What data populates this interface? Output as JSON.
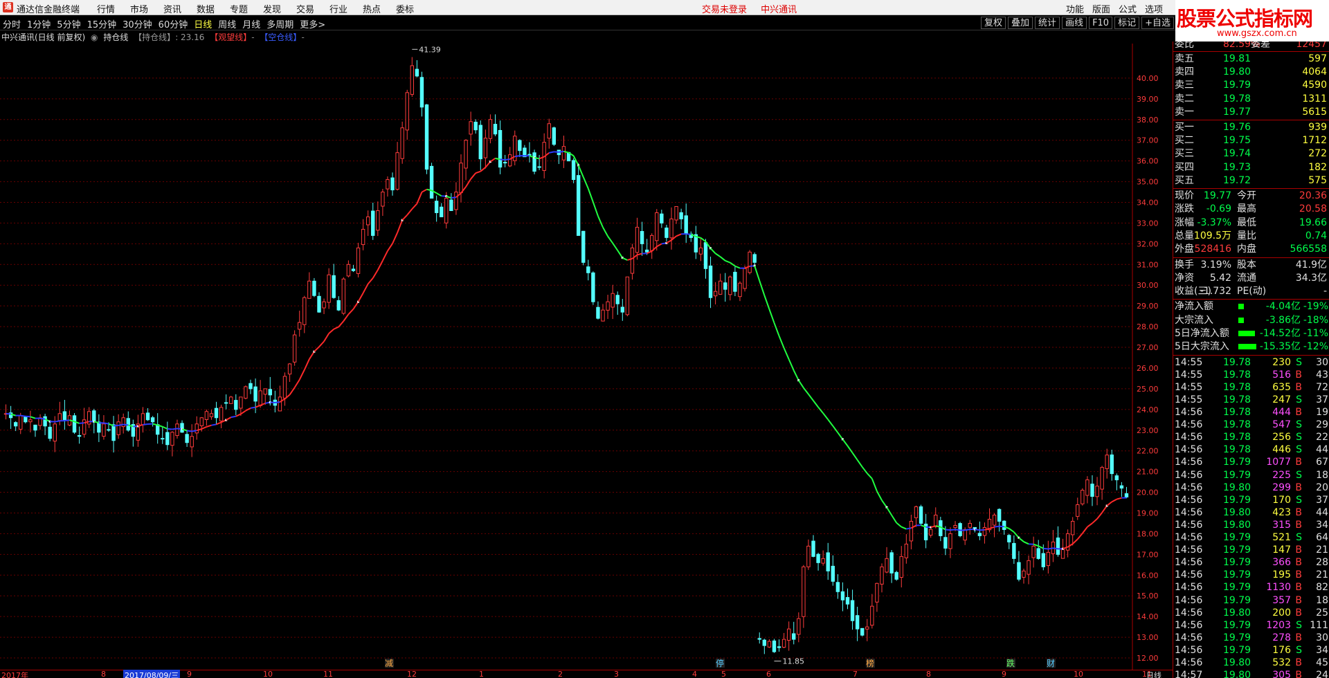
{
  "titlebar": {
    "logo": "通",
    "app_title": "通达信金融终端",
    "menu": [
      "行情",
      "市场",
      "资讯",
      "数据",
      "专题",
      "发现",
      "交易",
      "行业",
      "热点",
      "委标"
    ],
    "center": [
      "交易未登录",
      "中兴通讯"
    ],
    "right_menu": [
      "功能",
      "版面",
      "公式",
      "选项"
    ],
    "watermark_title": "股票公式指标网",
    "watermark_url": "www.gszx.com.cn"
  },
  "toolbar": {
    "periods": [
      "分时",
      "1分钟",
      "5分钟",
      "15分钟",
      "30分钟",
      "60分钟",
      "日线",
      "周线",
      "月线",
      "多周期",
      "更多>"
    ],
    "active_period": "日线",
    "tools": [
      "复权",
      "叠加",
      "统计",
      "画线",
      "F10",
      "标记",
      "+自选",
      "返回"
    ]
  },
  "infobar": {
    "stock": "中兴通讯(日线 前复权)",
    "indicator": "持仓线",
    "label_hold": "【持仓线】",
    "hold_value": ": 23.16",
    "label_watch": "【观望线】",
    "label_short": "【空仓线】",
    "dash": "-"
  },
  "chart_data": {
    "type": "candlestick",
    "y_axis_ticks": [
      "40.00",
      "39.00",
      "38.00",
      "37.00",
      "36.00",
      "35.00",
      "34.00",
      "33.00",
      "32.00",
      "31.00",
      "30.00",
      "29.00",
      "28.00",
      "27.00",
      "26.00",
      "25.00",
      "24.00",
      "23.00",
      "22.00",
      "21.00",
      "20.00",
      "19.00",
      "18.00",
      "17.00",
      "16.00",
      "15.00",
      "14.00",
      "13.00",
      "12.00"
    ],
    "ylim": [
      11.6,
      41.5
    ],
    "high_label": "41.39",
    "low_label": "11.85",
    "date_labels": [
      "2017年",
      "8",
      "2017/08/09/三",
      "9",
      "10",
      "11",
      "12",
      "1",
      "2",
      "3",
      "4",
      "5",
      "6",
      "7",
      "8",
      "9",
      "10",
      "11",
      "日线"
    ],
    "event_markers": [
      "减",
      "停",
      "榜",
      "跌",
      "财"
    ],
    "closes": [
      23.8,
      23.6,
      23.2,
      23.7,
      23.4,
      23.5,
      23.0,
      23.6,
      23.2,
      22.6,
      23.3,
      23.8,
      23.5,
      23.7,
      22.9,
      22.7,
      23.5,
      23.9,
      23.4,
      22.9,
      23.3,
      23.0,
      22.5,
      23.4,
      23.6,
      23.0,
      22.7,
      23.3,
      23.8,
      23.5,
      23.4,
      22.8,
      22.6,
      22.3,
      22.9,
      23.3,
      22.9,
      22.4,
      22.7,
      23.3,
      23.6,
      23.9,
      23.8,
      23.6,
      24.1,
      24.3,
      24.6,
      24.0,
      24.6,
      25.1,
      25.0,
      24.4,
      24.9,
      25.0,
      24.7,
      24.2,
      24.6,
      25.6,
      26.2,
      27.6,
      28.2,
      29.4,
      30.2,
      29.5,
      28.7,
      29.2,
      30.5,
      29.4,
      28.8,
      30.3,
      31.0,
      30.7,
      31.8,
      32.7,
      33.3,
      32.4,
      33.6,
      34.5,
      35.1,
      34.6,
      36.4,
      37.6,
      39.3,
      40.6,
      40.1,
      38.6,
      35.6,
      34.2,
      33.5,
      33.3,
      34.2,
      33.6,
      34.5,
      35.9,
      37.0,
      37.9,
      37.5,
      36.1,
      37.1,
      38.0,
      37.3,
      35.7,
      35.9,
      36.3,
      37.2,
      36.5,
      36.2,
      36.3,
      35.5,
      35.7,
      36.9,
      37.8,
      36.8,
      36.3,
      36.7,
      36.0,
      35.1,
      32.4,
      31.1,
      30.6,
      29.2,
      28.4,
      28.8,
      29.2,
      29.6,
      29.1,
      28.7,
      30.4,
      31.8,
      32.8,
      32.0,
      31.6,
      32.4,
      33.5,
      33.0,
      32.3,
      33.2,
      33.8,
      33.2,
      32.5,
      32.3,
      31.6,
      31.8,
      30.8,
      29.4,
      29.7,
      30.2,
      29.8,
      30.4,
      29.7,
      30.1,
      30.8,
      31.6,
      31.1,
      12.9,
      12.6,
      12.8,
      12.3,
      12.5,
      12.9,
      13.4,
      12.9,
      13.9,
      16.4,
      17.4,
      16.9,
      16.6,
      16.8,
      16.2,
      15.7,
      15.2,
      14.8,
      14.6,
      13.8,
      13.4,
      13.1,
      13.5,
      14.5,
      15.6,
      16.4,
      16.8,
      16.1,
      15.8,
      16.9,
      17.5,
      18.6,
      19.3,
      18.5,
      17.7,
      18.2,
      18.9,
      17.9,
      17.3,
      18.0,
      18.4,
      17.9,
      18.2,
      18.5,
      18.2,
      17.9,
      18.3,
      18.7,
      18.9,
      18.6,
      18.2,
      17.6,
      16.8,
      15.8,
      16.2,
      16.7,
      17.4,
      16.8,
      16.4,
      17.1,
      17.6,
      17.0,
      17.3,
      18.0,
      18.6,
      19.4,
      20.1,
      20.6,
      19.8,
      20.3,
      21.2,
      21.8,
      20.9,
      20.6,
      20.2,
      19.77
    ]
  },
  "panel": {
    "top_row": {
      "label": "委比",
      "value": "82.59%",
      "label2": "委差",
      "value2": "12457"
    },
    "sell": [
      {
        "label": "卖五",
        "price": "19.81",
        "vol": "597"
      },
      {
        "label": "卖四",
        "price": "19.80",
        "vol": "4064"
      },
      {
        "label": "卖三",
        "price": "19.79",
        "vol": "4590"
      },
      {
        "label": "卖二",
        "price": "19.78",
        "vol": "1311"
      },
      {
        "label": "卖一",
        "price": "19.77",
        "vol": "5615"
      }
    ],
    "buy": [
      {
        "label": "买一",
        "price": "19.76",
        "vol": "939"
      },
      {
        "label": "买二",
        "price": "19.75",
        "vol": "1712"
      },
      {
        "label": "买三",
        "price": "19.74",
        "vol": "272"
      },
      {
        "label": "买四",
        "price": "19.73",
        "vol": "182"
      },
      {
        "label": "买五",
        "price": "19.72",
        "vol": "575"
      }
    ],
    "quote": [
      {
        "l1": "现价",
        "v1": "19.77",
        "l2": "今开",
        "v2": "20.36"
      },
      {
        "l1": "涨跌",
        "v1": "-0.69",
        "l2": "最高",
        "v2": "20.58"
      },
      {
        "l1": "涨幅",
        "v1": "-3.37%",
        "l2": "最低",
        "v2": "19.66"
      },
      {
        "l1": "总量",
        "v1": "109.5万",
        "l2": "量比",
        "v2": "0.74"
      },
      {
        "l1": "外盘",
        "v1": "528416",
        "l2": "内盘",
        "v2": "566558"
      }
    ],
    "stats": [
      {
        "l1": "换手",
        "v1": "3.19%",
        "l2": "股本",
        "v2": "41.9亿"
      },
      {
        "l1": "净资",
        "v1": "5.42",
        "l2": "流通",
        "v2": "34.3亿"
      },
      {
        "l1": "收益(三)",
        "v1": "-1.732",
        "l2": "PE(动)",
        "v2": "-"
      }
    ],
    "flows": [
      {
        "label": "净流入额",
        "value": "-4.04亿",
        "pct": "-19%",
        "bar": 0.2
      },
      {
        "label": "大宗流入",
        "value": "-3.86亿",
        "pct": "-18%",
        "bar": 0.2
      },
      {
        "label": "5日净流入额",
        "value": "-14.52亿",
        "pct": "-11%",
        "bar": 0.6
      },
      {
        "label": "5日大宗流入",
        "value": "-15.35亿",
        "pct": "-12%",
        "bar": 0.65
      }
    ],
    "ticks": [
      [
        "14:55",
        "19.78",
        "230",
        "S",
        "30"
      ],
      [
        "14:55",
        "19.78",
        "516",
        "B",
        "43"
      ],
      [
        "14:55",
        "19.78",
        "635",
        "B",
        "72"
      ],
      [
        "14:55",
        "19.78",
        "247",
        "S",
        "37"
      ],
      [
        "14:56",
        "19.78",
        "444",
        "B",
        "19"
      ],
      [
        "14:56",
        "19.78",
        "547",
        "S",
        "29"
      ],
      [
        "14:56",
        "19.78",
        "256",
        "S",
        "22"
      ],
      [
        "14:56",
        "19.78",
        "446",
        "S",
        "44"
      ],
      [
        "14:56",
        "19.79",
        "1077",
        "B",
        "67"
      ],
      [
        "14:56",
        "19.79",
        "225",
        "S",
        "18"
      ],
      [
        "14:56",
        "19.80",
        "299",
        "B",
        "20"
      ],
      [
        "14:56",
        "19.79",
        "170",
        "S",
        "37"
      ],
      [
        "14:56",
        "19.80",
        "423",
        "B",
        "44"
      ],
      [
        "14:56",
        "19.80",
        "315",
        "B",
        "34"
      ],
      [
        "14:56",
        "19.79",
        "521",
        "S",
        "64"
      ],
      [
        "14:56",
        "19.79",
        "147",
        "B",
        "21"
      ],
      [
        "14:56",
        "19.79",
        "366",
        "B",
        "28"
      ],
      [
        "14:56",
        "19.79",
        "195",
        "B",
        "21"
      ],
      [
        "14:56",
        "19.79",
        "1130",
        "B",
        "82"
      ],
      [
        "14:56",
        "19.79",
        "357",
        "B",
        "18"
      ],
      [
        "14:56",
        "19.80",
        "200",
        "B",
        "25"
      ],
      [
        "14:56",
        "19.79",
        "1203",
        "S",
        "111"
      ],
      [
        "14:56",
        "19.79",
        "278",
        "B",
        "30"
      ],
      [
        "14:56",
        "19.79",
        "176",
        "S",
        "34"
      ],
      [
        "14:56",
        "19.80",
        "532",
        "B",
        "45"
      ],
      [
        "14:57",
        "19.80",
        "305",
        "B",
        "24"
      ]
    ]
  }
}
